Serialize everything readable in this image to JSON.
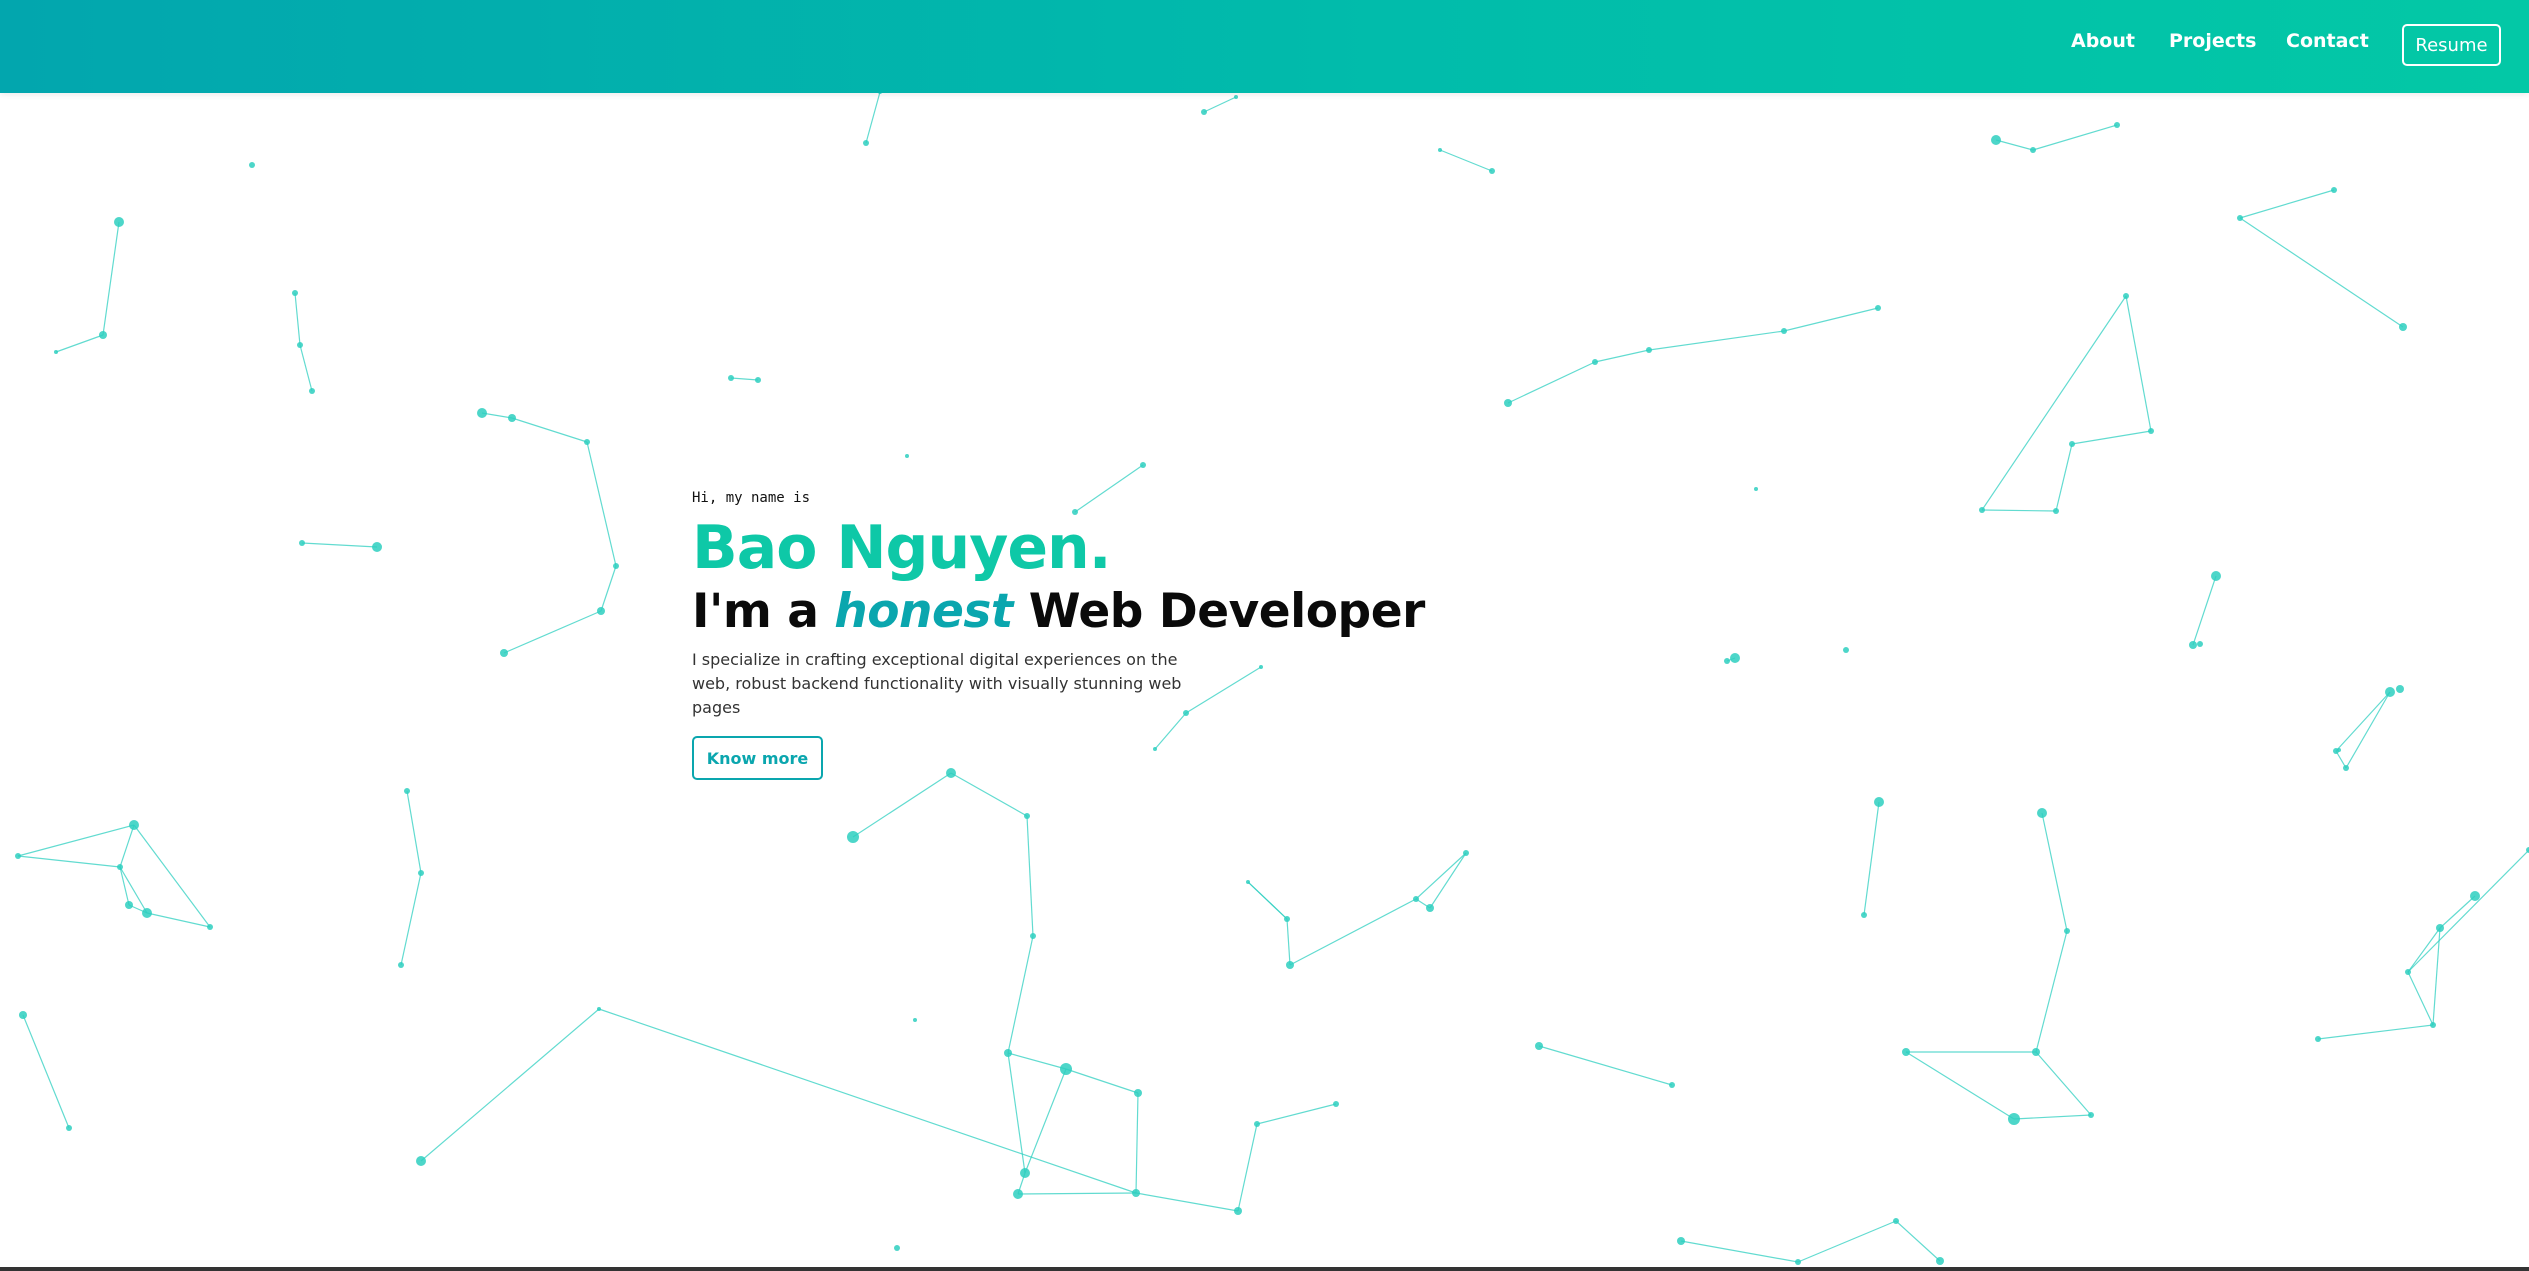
{
  "nav": {
    "links": [
      "About",
      "Projects",
      "Contact"
    ],
    "resume_label": "Resume"
  },
  "hero": {
    "greeting": "Hi, my name is",
    "name": "Bao Nguyen.",
    "tagline_prefix": "I'm a ",
    "tagline_adjective": "honest",
    "tagline_suffix": " Web Developer",
    "bio": "I specialize in crafting exceptional digital experiences on the web, robust backend functionality with visually stunning web pages",
    "cta_label": "Know more"
  },
  "colors": {
    "accent": "#0ec8a7",
    "accent_dark": "#0aa6ae",
    "nav_gradient_start": "#02a6ae",
    "nav_gradient_end": "#03c8a6",
    "particle": "#2ecfc0"
  },
  "background": {
    "icon": "particle-network-icon"
  }
}
